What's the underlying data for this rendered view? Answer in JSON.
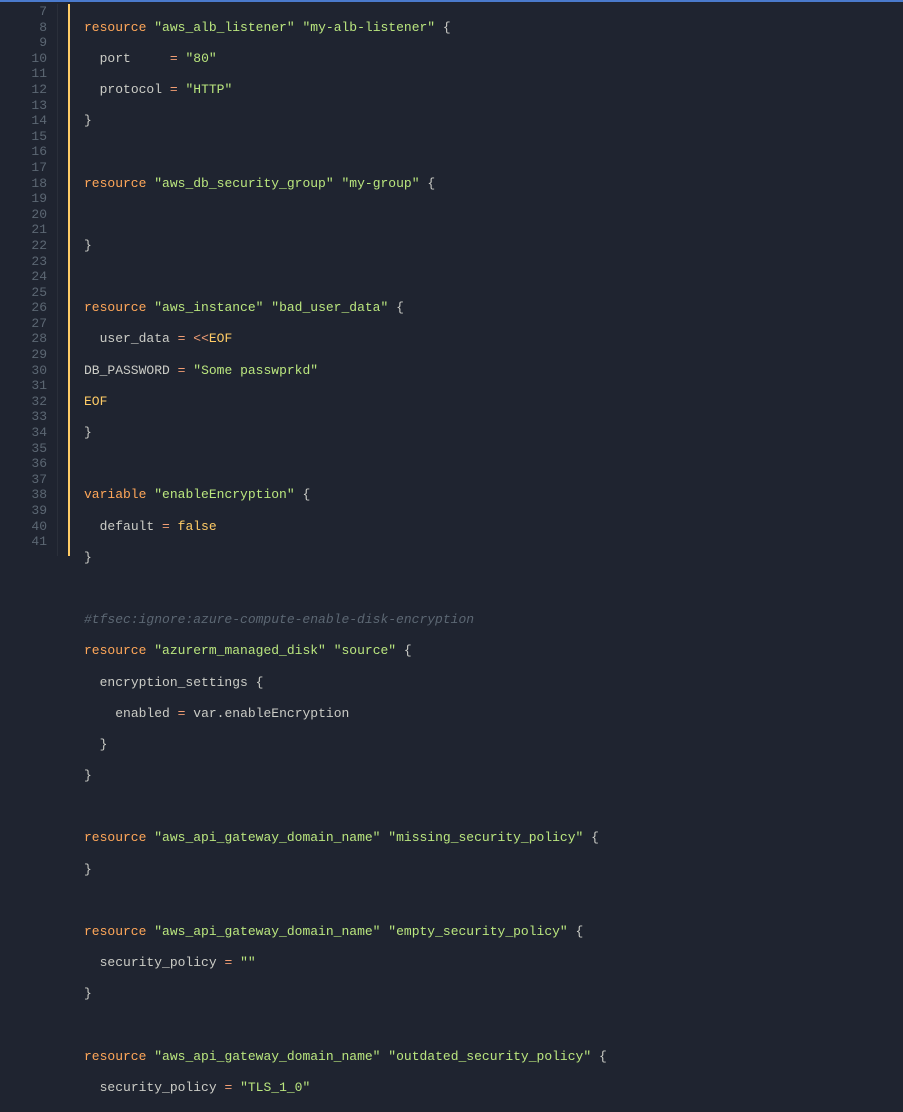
{
  "editor": {
    "startLine": 7,
    "endLine": 41,
    "tokens": {
      "resource": "resource",
      "variable": "variable",
      "port": "port",
      "protocol": "protocol",
      "user_data": "user_data",
      "default": "default",
      "enabled": "enabled",
      "security_policy": "security_policy",
      "encryption_settings": "encryption_settings",
      "db_password": "DB_PASSWORD",
      "eof": "EOF",
      "heredoc": "<<",
      "var": "var",
      "dot": ".",
      "enableEncryption": "enableEncryption",
      "eq": "=",
      "lbrace": "{",
      "rbrace": "}",
      "false": "false"
    },
    "strings": {
      "aws_alb_listener": "\"aws_alb_listener\"",
      "my_alb_listener": "\"my-alb-listener\"",
      "eighty": "\"80\"",
      "http": "\"HTTP\"",
      "aws_db_security_group": "\"aws_db_security_group\"",
      "my_group": "\"my-group\"",
      "aws_instance": "\"aws_instance\"",
      "bad_user_data": "\"bad_user_data\"",
      "some_passwprkd": "\"Some passwprkd\"",
      "enableEncryption": "\"enableEncryption\"",
      "azurerm_managed_disk": "\"azurerm_managed_disk\"",
      "source": "\"source\"",
      "aws_api_gateway_domain_name": "\"aws_api_gateway_domain_name\"",
      "missing_security_policy": "\"missing_security_policy\"",
      "empty_security_policy": "\"empty_security_policy\"",
      "empty": "\"\"",
      "outdated_security_policy": "\"outdated_security_policy\"",
      "tls_1_0": "\"TLS_1_0\""
    },
    "comment": "#tfsec:ignore:azure-compute-enable-disk-encryption"
  }
}
